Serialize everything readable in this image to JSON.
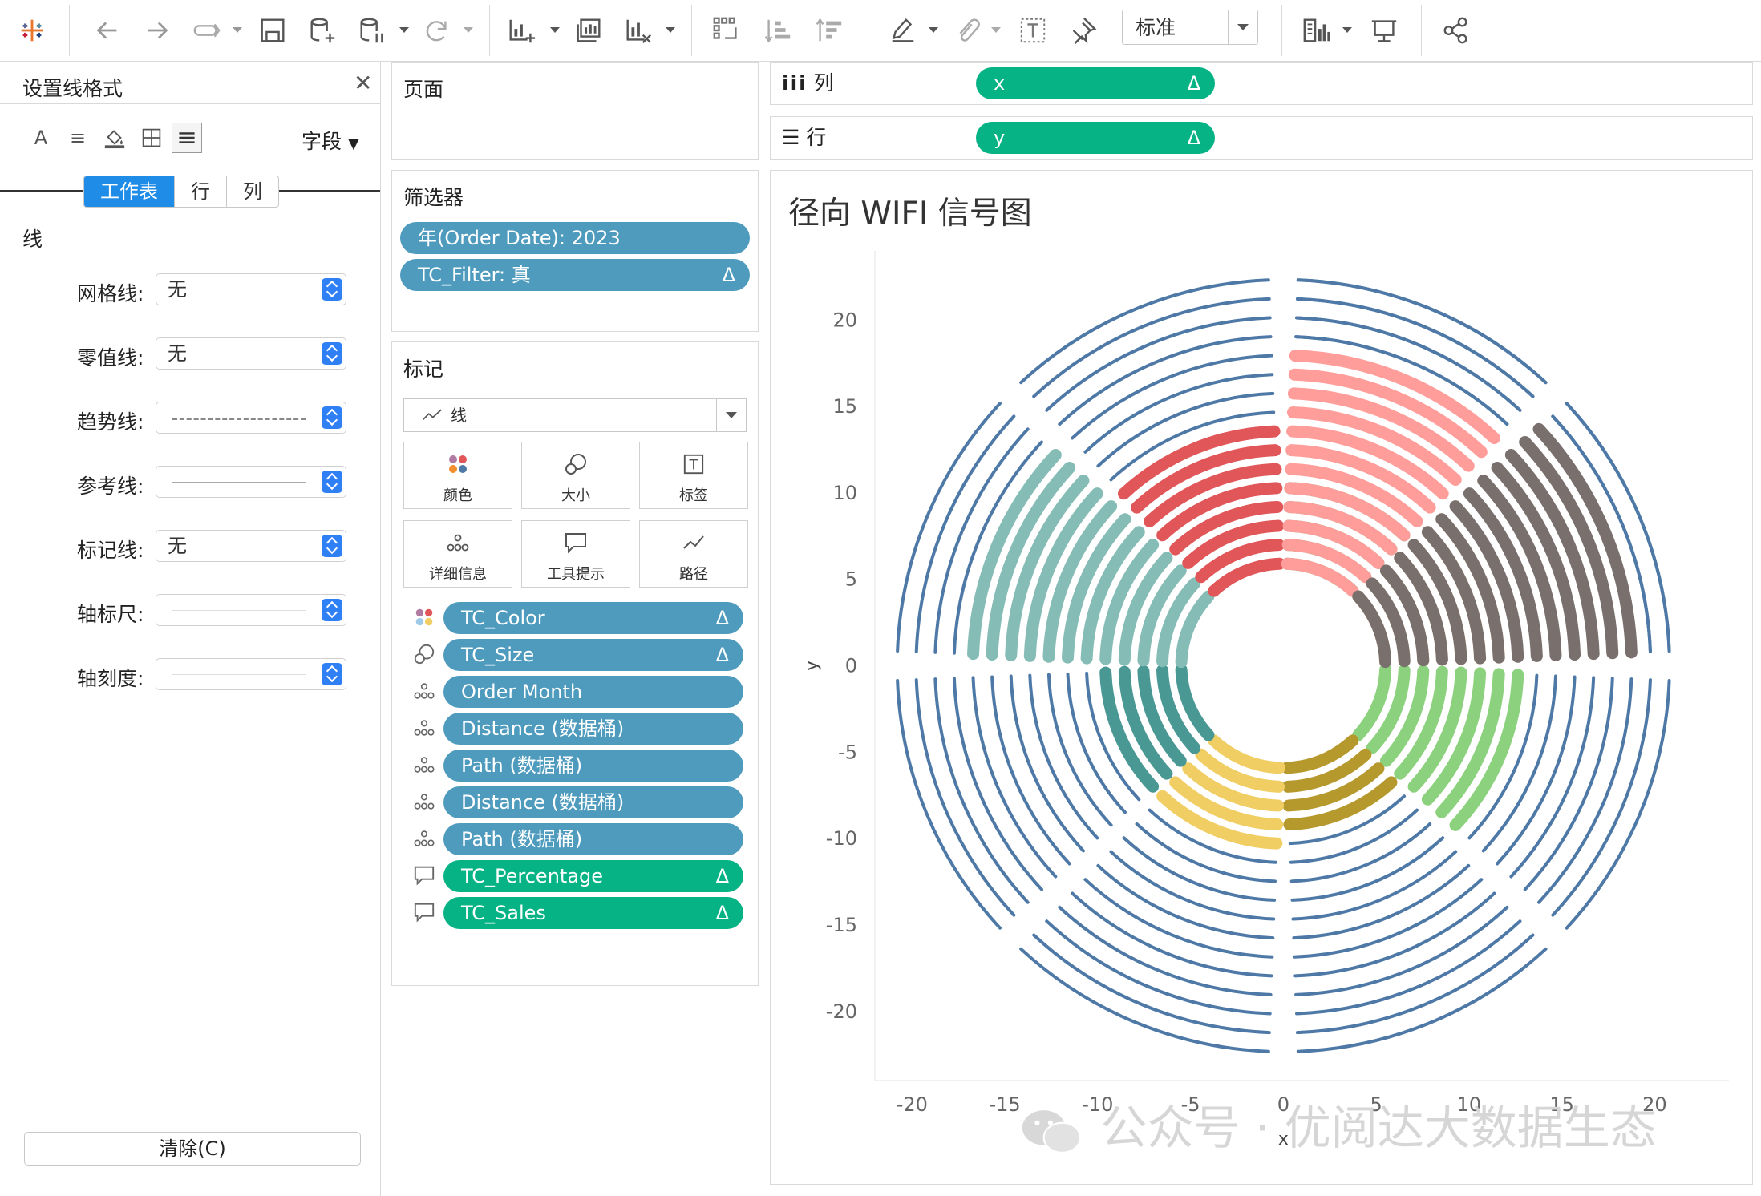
{
  "toolbar": {
    "zoom_value": "标准",
    "icons": [
      "tableau-logo-icon",
      "back-icon",
      "forward-icon",
      "redo-icon",
      "save-icon",
      "new-datasource-icon",
      "pause-datasource-icon",
      "refresh-icon",
      "new-worksheet-icon",
      "duplicate-icon",
      "clear-sheet-icon",
      "swap-icon",
      "sort-asc-icon",
      "sort-desc-icon",
      "highlight-icon",
      "group-icon",
      "label-icon",
      "pin-icon",
      "show-me-icon",
      "presentation-icon",
      "share-icon"
    ]
  },
  "format_pane": {
    "title": "设置线格式",
    "fields_dropdown": "字段",
    "tabs": [
      "工作表",
      "行",
      "列"
    ],
    "section": "线",
    "rows": [
      {
        "label": "网格线:",
        "value": "无"
      },
      {
        "label": "零值线:",
        "value": "无"
      },
      {
        "label": "趋势线:",
        "value": ""
      },
      {
        "label": "参考线:",
        "value": ""
      },
      {
        "label": "标记线:",
        "value": "无"
      },
      {
        "label": "轴标尺:",
        "value": ""
      },
      {
        "label": "轴刻度:",
        "value": ""
      }
    ],
    "clear_button": "清除(C)"
  },
  "pages_card": {
    "title": "页面"
  },
  "filters_card": {
    "title": "筛选器",
    "filters": [
      {
        "label": "年(Order Date): 2023",
        "delta": ""
      },
      {
        "label": "TC_Filter: 真",
        "delta": "Δ"
      }
    ]
  },
  "marks_card": {
    "title": "标记",
    "mark_type": "线",
    "buttons": [
      "颜色",
      "大小",
      "标签",
      "详细信息",
      "工具提示",
      "路径"
    ],
    "fields": [
      {
        "label": "TC_Color",
        "delta": "Δ",
        "color": "blue",
        "icon": "color-icon"
      },
      {
        "label": "TC_Size",
        "delta": "Δ",
        "color": "blue",
        "icon": "size-icon"
      },
      {
        "label": "Order Month",
        "delta": "",
        "color": "blue",
        "icon": "detail-icon"
      },
      {
        "label": "Distance (数据桶)",
        "delta": "",
        "color": "blue",
        "icon": "detail-icon"
      },
      {
        "label": "Path (数据桶)",
        "delta": "",
        "color": "blue",
        "icon": "detail-icon"
      },
      {
        "label": "Distance (数据桶)",
        "delta": "",
        "color": "blue",
        "icon": "detail-icon"
      },
      {
        "label": "Path (数据桶)",
        "delta": "",
        "color": "blue",
        "icon": "detail-icon"
      },
      {
        "label": "TC_Percentage",
        "delta": "Δ",
        "color": "green",
        "icon": "tooltip-icon"
      },
      {
        "label": "TC_Sales",
        "delta": "Δ",
        "color": "green",
        "icon": "tooltip-icon"
      }
    ]
  },
  "columns_shelf": {
    "label": "列",
    "pill": "x",
    "delta": "Δ"
  },
  "rows_shelf": {
    "label": "行",
    "pill": "y",
    "delta": "Δ"
  },
  "chart_data": {
    "type": "radial",
    "title": "径向 WIFI 信号图",
    "xlabel": "x",
    "ylabel": "y",
    "xlim": [
      -22,
      24
    ],
    "ylim": [
      -24,
      24
    ],
    "x_ticks": [
      -20,
      -15,
      -10,
      -5,
      0,
      5,
      10,
      15,
      20
    ],
    "y_ticks": [
      20,
      15,
      10,
      5,
      0,
      -5,
      -10,
      -15,
      -20
    ],
    "grid": false,
    "inner_radius": 5.5,
    "ring_step": 1.02,
    "total_rings": 16,
    "background_color": "#4e79a7",
    "segments": [
      {
        "start_deg": 0,
        "end_deg": 45,
        "colored_rings": 5,
        "inner_color": "#59a14f",
        "outer_color": "#59a14f",
        "inner_count": 6
      },
      {
        "start_deg": 45,
        "end_deg": 90,
        "colored_rings": 7,
        "inner_color": "#ffbe7d",
        "outer_color": "#ffbe7d",
        "inner_count": 7
      },
      {
        "start_deg": 90,
        "end_deg": 135,
        "colored_rings": 8,
        "inner_color": "#59a14f",
        "outer_color": "#8cd17d",
        "inner_count": 0
      },
      {
        "start_deg": 135,
        "end_deg": 180,
        "colored_rings": 4,
        "inner_color": "#b6992d",
        "outer_color": "#b6992d",
        "inner_count": 4
      },
      {
        "start_deg": 180,
        "end_deg": 225,
        "colored_rings": 5,
        "inner_color": "#f1ce63",
        "outer_color": "#f1ce63",
        "inner_count": 5
      },
      {
        "start_deg": 225,
        "end_deg": 270,
        "colored_rings": 5,
        "inner_color": "#499894",
        "outer_color": "#86bcb6",
        "inner_count": 5
      },
      {
        "start_deg": 270,
        "end_deg": 315,
        "colored_rings": 12,
        "inner_color": "#86bcb6",
        "outer_color": "#86bcb6",
        "inner_count": 12
      },
      {
        "start_deg": 315,
        "end_deg": 360,
        "colored_rings": 8,
        "inner_color": "#e15759",
        "outer_color": "#e15759",
        "inner_count": 8
      },
      {
        "start_deg": 360,
        "end_deg": 405,
        "colored_rings": 12,
        "inner_color": "#e15759",
        "outer_color": "#ff9d9a",
        "inner_count": 0
      },
      {
        "start_deg": 405,
        "end_deg": 450,
        "colored_rings": 14,
        "inner_color": "#79706e",
        "outer_color": "#79706e",
        "inner_count": 14
      }
    ],
    "top_inner": [
      {
        "start_deg": 0,
        "end_deg": 22,
        "colored_rings": 3,
        "color": "#a0cbe8"
      },
      {
        "start_deg": 22,
        "end_deg": 45,
        "colored_rings": 4,
        "color": "#f28e2b"
      }
    ]
  },
  "watermark": "公众号 · 优阅达大数据生态"
}
